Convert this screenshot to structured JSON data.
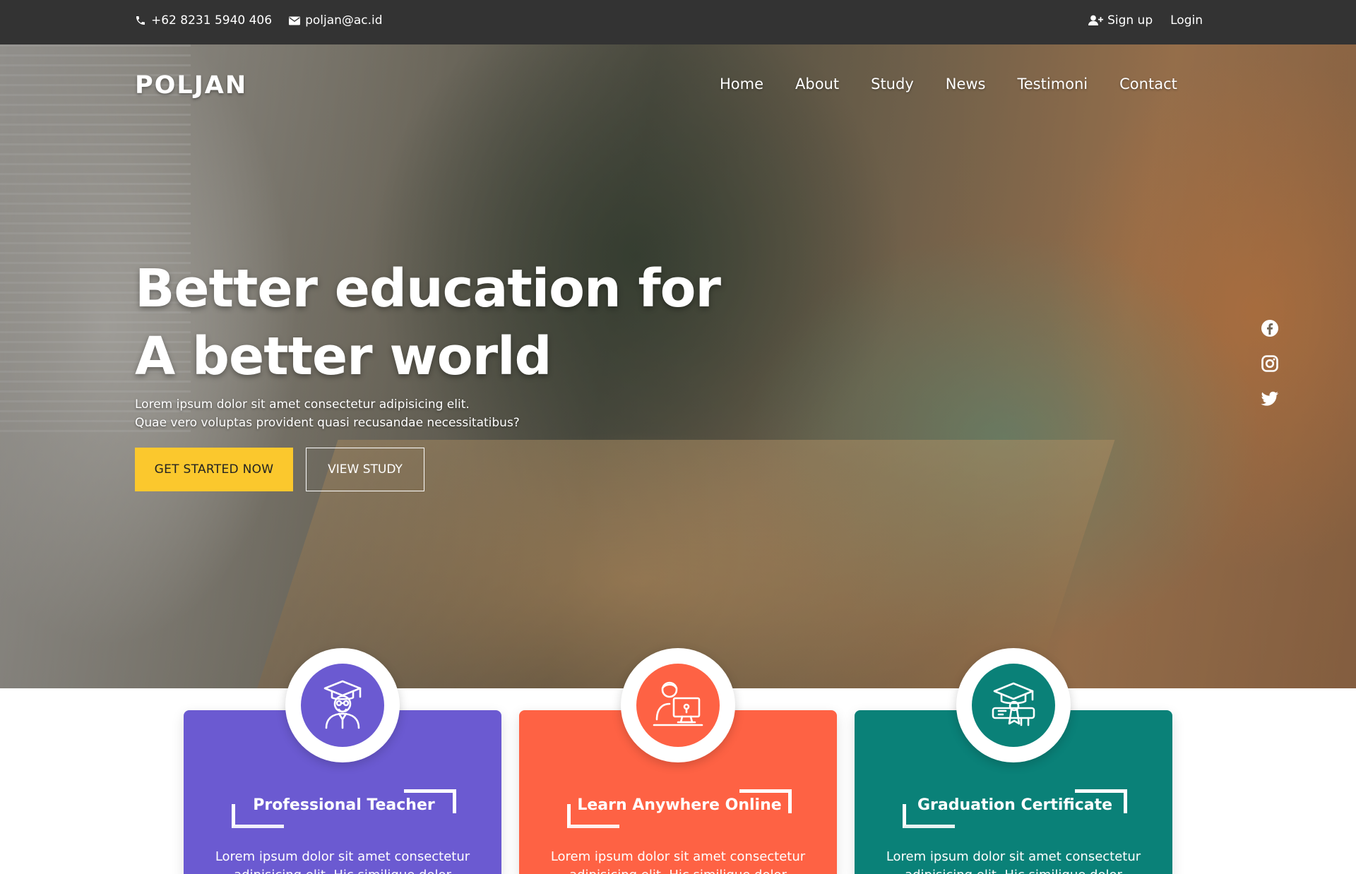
{
  "topbar": {
    "phone": "+62 8231 5940 406",
    "email": "poljan@ac.id",
    "signup_label": "Sign up",
    "login_label": "Login"
  },
  "brand": {
    "logo": "POLJAN"
  },
  "nav": {
    "items": [
      {
        "label": "Home"
      },
      {
        "label": "About"
      },
      {
        "label": "Study"
      },
      {
        "label": "News"
      },
      {
        "label": "Testimoni"
      },
      {
        "label": "Contact"
      }
    ]
  },
  "hero": {
    "title_line1": "Better education for",
    "title_line2": "A better world",
    "subtitle_line1": "Lorem ipsum dolor sit amet consectetur adipisicing elit.",
    "subtitle_line2": "Quae vero voluptas provident quasi recusandae necessitatibus?",
    "primary_button": "GET STARTED NOW",
    "secondary_button": "VIEW STUDY"
  },
  "socials": [
    {
      "icon": "facebook-icon"
    },
    {
      "icon": "instagram-icon"
    },
    {
      "icon": "twitter-icon"
    }
  ],
  "features": [
    {
      "title": "Professional Teacher",
      "description": "Lorem ipsum dolor sit amet consectetur adipisicing elit. Hic similique dolor",
      "color": "#6b5ad1",
      "icon": "teacher-icon"
    },
    {
      "title": "Learn Anywhere Online",
      "description": "Lorem ipsum dolor sit amet consectetur adipisicing elit. Hic similique dolor",
      "color": "#fe6244",
      "icon": "online-learning-icon"
    },
    {
      "title": "Graduation Certificate",
      "description": "Lorem ipsum dolor sit amet consectetur adipisicing elit. Hic similique dolor",
      "color": "#0a8178",
      "icon": "graduation-certificate-icon"
    }
  ],
  "colors": {
    "topbar": "#333333",
    "accent_yellow": "#fbc82d"
  }
}
